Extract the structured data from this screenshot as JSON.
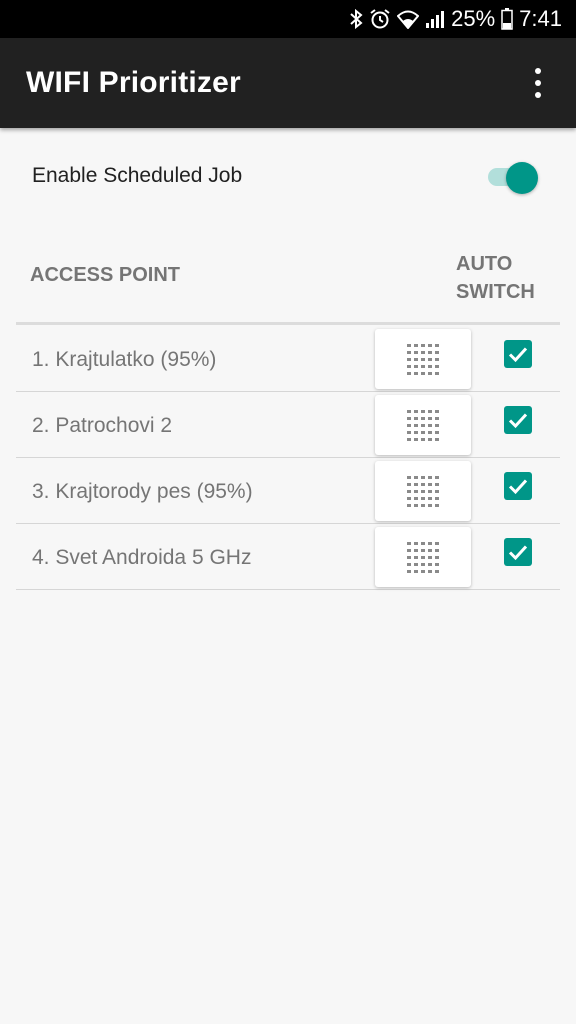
{
  "status_bar": {
    "battery_percent": "25%",
    "time": "7:41",
    "icons": [
      "bluetooth-icon",
      "alarm-icon",
      "wifi-icon",
      "signal-icon",
      "battery-icon"
    ]
  },
  "app_bar": {
    "title": "WIFI Prioritizer",
    "overflow_icon": "more-vert-icon"
  },
  "schedule": {
    "label": "Enable Scheduled Job",
    "enabled": true
  },
  "table": {
    "col_access_point": "ACCESS POINT",
    "col_auto_switch_line1": "AUTO",
    "col_auto_switch_line2": "SWITCH",
    "rows": [
      {
        "label": "1. Krajtulatko (95%)",
        "auto_switch": true
      },
      {
        "label": "2. Patrochovi 2",
        "auto_switch": true
      },
      {
        "label": "3. Krajtorody pes (95%)",
        "auto_switch": true
      },
      {
        "label": "4. Svet Androida 5 GHz",
        "auto_switch": true
      }
    ]
  },
  "colors": {
    "accent": "#009688",
    "app_bar": "#212121",
    "status_bar": "#000000",
    "background": "#f7f7f7"
  }
}
